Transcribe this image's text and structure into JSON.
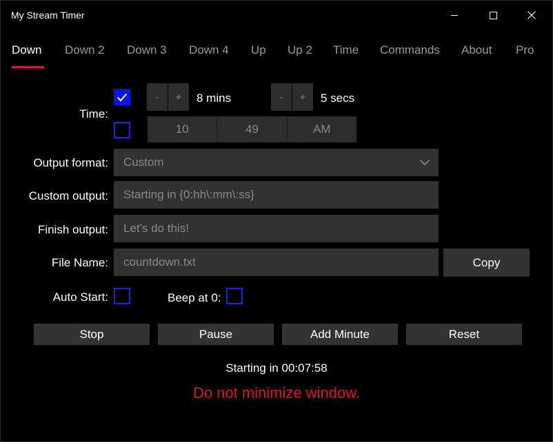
{
  "window": {
    "title": "My Stream Timer"
  },
  "tabs": [
    {
      "label": "Down",
      "active": true
    },
    {
      "label": "Down 2"
    },
    {
      "label": "Down 3"
    },
    {
      "label": "Down 4"
    },
    {
      "label": "Up"
    },
    {
      "label": "Up 2"
    },
    {
      "label": "Time"
    },
    {
      "label": "Commands"
    },
    {
      "label": "About"
    },
    {
      "label": "Pro"
    }
  ],
  "time": {
    "label": "Time:",
    "duration_checked": true,
    "clock_checked": false,
    "minus": "-",
    "plus": "+",
    "minutes_text": "8 mins",
    "seconds_text": "5 secs",
    "clock_hour": "10",
    "clock_minute": "49",
    "clock_period": "AM"
  },
  "output_format": {
    "label": "Output format:",
    "value": "Custom",
    "options": [
      "Custom"
    ]
  },
  "custom_output": {
    "label": "Custom output:",
    "placeholder": "Starting in {0:hh\\:mm\\:ss}"
  },
  "finish_output": {
    "label": "Finish output:",
    "placeholder": "Let's do this!"
  },
  "file_name": {
    "label": "File Name:",
    "placeholder": "countdown.txt",
    "copy_label": "Copy"
  },
  "auto_start": {
    "label": "Auto Start:",
    "checked": false
  },
  "beep": {
    "label": "Beep at 0:",
    "checked": false
  },
  "actions": {
    "stop": "Stop",
    "pause": "Pause",
    "add_minute": "Add Minute",
    "reset": "Reset"
  },
  "status_text": "Starting in 00:07:58",
  "warning_text": "Do not minimize window.",
  "colors": {
    "accent": "#e0103c",
    "checkbox": "#0a14e6",
    "warning": "#e81123"
  }
}
